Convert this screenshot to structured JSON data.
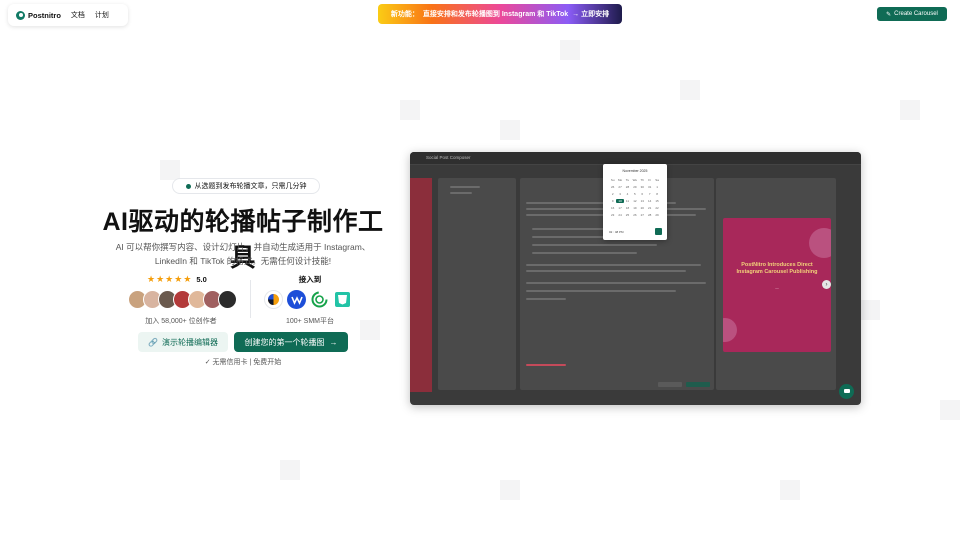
{
  "header": {
    "logo_text": "Postnitro",
    "nav": [
      "文档",
      "计划"
    ],
    "announcement": {
      "label": "新功能：",
      "text": "直接安排和发布轮播图到 Instagram 和 TikTok",
      "cta": "→ 立即安排"
    },
    "create_button": "Create Carousel"
  },
  "hero": {
    "badge": "从选题到发布轮播文章，只需几分钟",
    "title": "AI驱动的轮播帖子制作工具",
    "subtitle": "AI 可以帮你撰写内容、设计幻灯片，并自动生成适用于 Instagram、LinkedIn 和 TikTok 的格式。无需任何设计技能!",
    "rating": "5.0",
    "creators": "加入 58,000+ 位创作者",
    "integrated_label": "接入到",
    "smm": "100+ SMM平台",
    "demo_button": "演示轮播编辑器",
    "primary_button": "创建您的第一个轮播图",
    "footnote": "无需信用卡 | 免费开始"
  },
  "preview": {
    "top_title": "Social Post Composer",
    "slide_title": "PostNitro Introduces Direct Instagram Carousel Publishing",
    "calendar_month": "November 2025",
    "calendar_days": [
      "Su",
      "Mo",
      "Tu",
      "We",
      "Th",
      "Fr",
      "Sa",
      "26",
      "27",
      "28",
      "29",
      "30",
      "31",
      "1",
      "2",
      "3",
      "4",
      "5",
      "6",
      "7",
      "8",
      "9",
      "10",
      "11",
      "12",
      "13",
      "14",
      "15",
      "16",
      "17",
      "18",
      "19",
      "20",
      "21",
      "22",
      "23",
      "24",
      "25",
      "26",
      "27",
      "28",
      "29"
    ],
    "calendar_selected": "10",
    "calendar_time": "02 : 48 PM"
  },
  "colors": {
    "brand": "#0f6b55",
    "brand_light": "#ecf5f2",
    "star": "#f59e0b",
    "slide": "#a8285a"
  }
}
